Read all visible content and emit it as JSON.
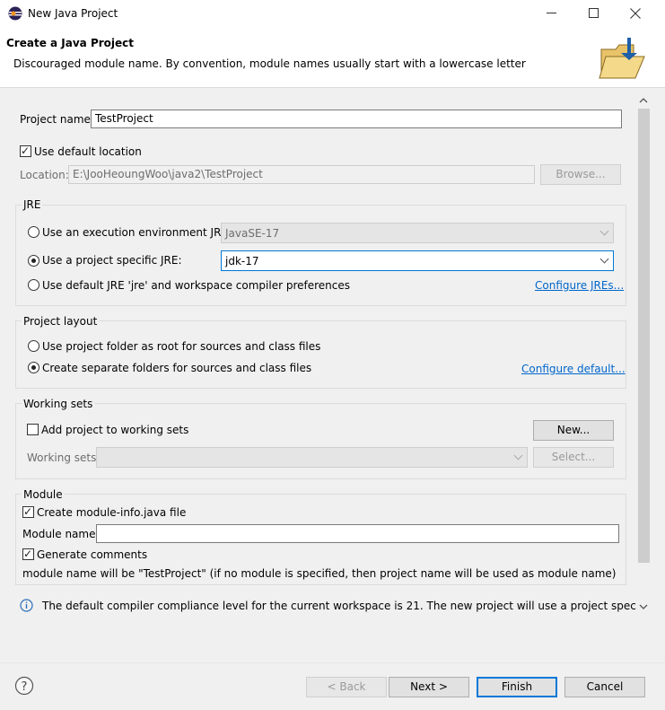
{
  "window": {
    "title": "New Java Project",
    "controls": [
      "minimize",
      "maximize",
      "close"
    ]
  },
  "banner": {
    "title": "Create a Java Project",
    "message": "Discouraged module name. By convention, module names usually start with a lowercase letter",
    "icon": "folder-wizard-icon"
  },
  "project": {
    "name_label": "Project name:",
    "name_value": "TestProject",
    "use_default_location_label": "Use default location",
    "use_default_location_checked": true,
    "location_label": "Location:",
    "location_value": "E:\\JooHeoungWoo\\java2\\TestProject",
    "browse_label": "Browse..."
  },
  "jre": {
    "group_label": "JRE",
    "exec_env_label": "Use an execution environment JRE:",
    "exec_env_value": "JavaSE-17",
    "specific_label": "Use a project specific JRE:",
    "specific_value": "jdk-17",
    "default_label": "Use default JRE 'jre' and workspace compiler preferences",
    "configure_link": "Configure JREs...",
    "selected": "specific"
  },
  "layout": {
    "group_label": "Project layout",
    "option_root": "Use project folder as root for sources and class files",
    "option_separate": "Create separate folders for sources and class files",
    "selected": "separate",
    "configure_link": "Configure default..."
  },
  "working_sets": {
    "group_label": "Working sets",
    "add_label": "Add project to working sets",
    "add_checked": false,
    "new_button": "New...",
    "sets_label": "Working sets:",
    "select_button": "Select..."
  },
  "module": {
    "group_label": "Module",
    "create_label": "Create module-info.java file",
    "create_checked": true,
    "name_label": "Module name:",
    "name_value": "",
    "generate_label": "Generate comments",
    "generate_checked": true,
    "note": "module name will be \"TestProject\"  (if no module is specified, then project name will be used as module name)"
  },
  "info": {
    "message": "The default compiler compliance level for the current workspace is 21. The new project will use a project specific"
  },
  "footer": {
    "back": "< Back",
    "next": "Next >",
    "finish": "Finish",
    "cancel": "Cancel"
  },
  "colors": {
    "accent": "#0078d7",
    "link": "#0066cc"
  }
}
